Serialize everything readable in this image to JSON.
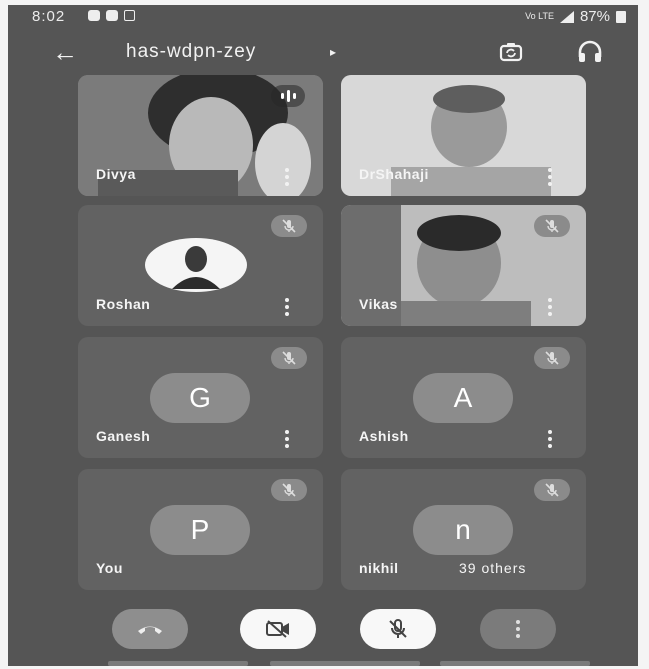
{
  "status_bar": {
    "time": "8:02",
    "signal_text": "Vo LTE",
    "battery": "87%"
  },
  "header": {
    "back_icon": "arrow-left-icon",
    "meeting_code": "has-wdpn-zey",
    "caret": "▸",
    "switch_camera_icon": "switch-camera-icon",
    "audio_icon": "headset-icon"
  },
  "participants": [
    {
      "name": "Divya",
      "type": "video",
      "state": "speaking"
    },
    {
      "name": "DrShahaji",
      "type": "video"
    },
    {
      "name": "Roshan",
      "type": "photo",
      "muted": true
    },
    {
      "name": "Vikas",
      "type": "video",
      "muted": true
    },
    {
      "name": "Ganesh",
      "initial": "G",
      "muted": true
    },
    {
      "name": "Ashish",
      "initial": "A",
      "muted": true
    },
    {
      "name": "You",
      "initial": "P",
      "muted": true
    },
    {
      "name": "nikhil",
      "initial": "n",
      "muted": true,
      "others": "39 others"
    }
  ],
  "controls": {
    "end_call": "end-call-icon",
    "camera": "camera-off-icon",
    "microphone": "mic-off-icon",
    "more": "more-vertical-icon"
  },
  "colors": {
    "screen_bg": "#555555",
    "tile_bg": "#626262",
    "avatar_bg": "#8c8c8c"
  }
}
